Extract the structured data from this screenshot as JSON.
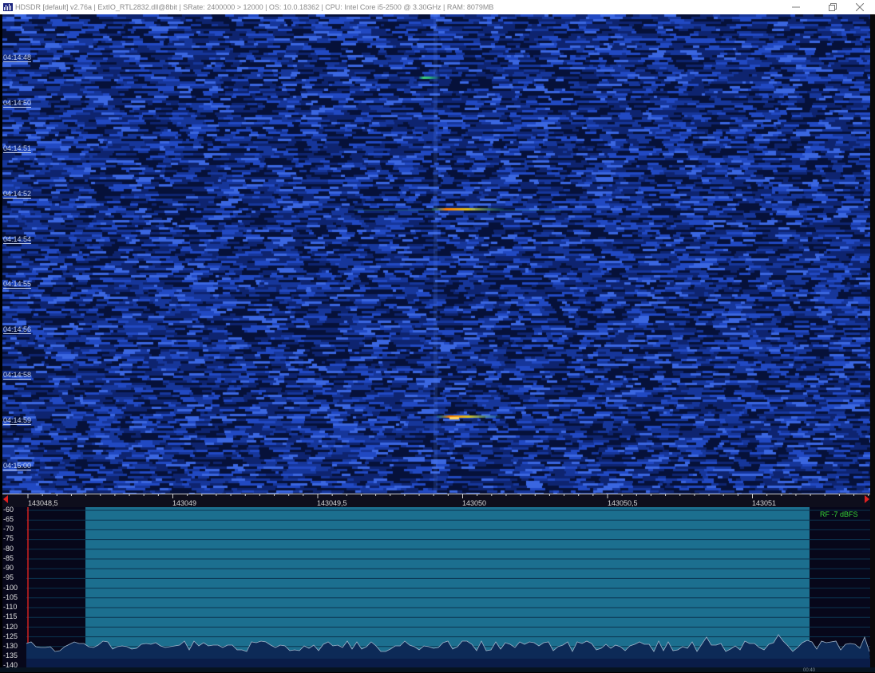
{
  "window": {
    "title": "HDSDR  [default]  v2.76a  |  ExtIO_RTL2832.dll@8bit  |  SRate: 2400000 > 12000  |  OS: 10.0.18362   |  CPU: Intel Core i5-2500 @ 3.30GHz  |  RAM: 8079MB",
    "icons": {
      "app": "hdsdr-app-icon",
      "minimize": "minimize-icon",
      "maximize": "restore-icon",
      "close": "close-icon"
    }
  },
  "waterfall": {
    "timestamps": [
      "04:14:48",
      "04:14:50",
      "04:14:51",
      "04:14:52",
      "04:14:54",
      "04:14:55",
      "04:14:56",
      "04:14:58",
      "04:14:59",
      "04:15:00"
    ]
  },
  "frequency_scale": {
    "labels": [
      "143048,5",
      "143049",
      "143049,5",
      "143050",
      "143050,5",
      "143051"
    ]
  },
  "spectrum": {
    "db_labels": [
      "-60",
      "-65",
      "-70",
      "-75",
      "-80",
      "-85",
      "-90",
      "-95",
      "-100",
      "-105",
      "-110",
      "-115",
      "-120",
      "-125",
      "-130",
      "-135",
      "-140"
    ],
    "rf_level": "RF  -7 dBFS",
    "clock": "00:40"
  },
  "colors": {
    "waterfall_bg": "#0b1e54",
    "passband": "#1c6f8f",
    "trace": "#0d2a57",
    "signal_hot": "#ff8a00",
    "rf_text": "#36d336"
  }
}
